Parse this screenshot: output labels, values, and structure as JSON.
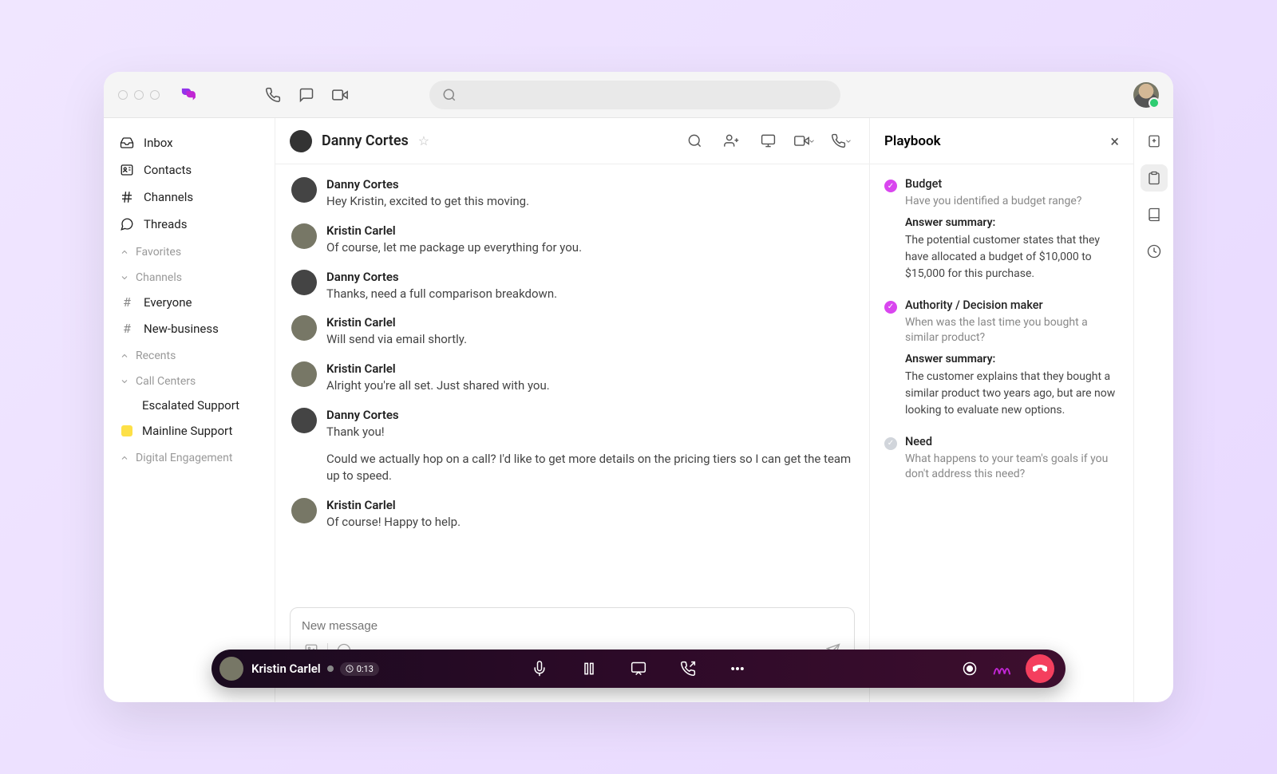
{
  "sidebar": {
    "main": [
      {
        "label": "Inbox"
      },
      {
        "label": "Contacts"
      },
      {
        "label": "Channels"
      },
      {
        "label": "Threads"
      }
    ],
    "favorites_label": "Favorites",
    "channels_label": "Channels",
    "channels": [
      {
        "label": "Everyone"
      },
      {
        "label": "New-business"
      }
    ],
    "recents_label": "Recents",
    "callcenters_label": "Call Centers",
    "callcenters": [
      {
        "label": "Escalated Support",
        "color": "#ec4899"
      },
      {
        "label": "Mainline Support",
        "color": "#fde047"
      }
    ],
    "digital_label": "Digital Engagement"
  },
  "conversation": {
    "title": "Danny Cortes",
    "messages": [
      {
        "name": "Danny Cortes",
        "text": "Hey Kristin, excited to get this moving.",
        "who": "a"
      },
      {
        "name": "Kristin Carlel",
        "text": "Of course, let me package up everything for you.",
        "who": "b"
      },
      {
        "name": "Danny Cortes",
        "text": "Thanks, need a full comparison breakdown.",
        "who": "a"
      },
      {
        "name": "Kristin Carlel",
        "text": "Will send via email shortly.",
        "who": "b"
      },
      {
        "name": "Kristin Carlel",
        "text": "Alright you're all set. Just shared with you.",
        "who": "b"
      },
      {
        "name": "Danny Cortes",
        "text": "Thank you!",
        "text2": "Could we actually hop on a call? I'd like to get more details on the pricing tiers so I can get the team up to speed.",
        "who": "a"
      },
      {
        "name": "Kristin Carlel",
        "text": "Of course! Happy to help.",
        "who": "b"
      }
    ],
    "composer_placeholder": "New message"
  },
  "playbook": {
    "title": "Playbook",
    "items": [
      {
        "status": "done",
        "title": "Budget",
        "question": "Have you identified a budget range?",
        "summary_label": "Answer summary:",
        "summary": "The potential customer states that they have allocated a budget of $10,000 to $15,000 for this purchase."
      },
      {
        "status": "done",
        "title": "Authority / Decision maker",
        "question": "When was the last time you bought a similar product?",
        "summary_label": "Answer summary:",
        "summary": "The customer explains that they bought a similar product two years ago, but are now looking to evaluate new options."
      },
      {
        "status": "pending",
        "title": "Need",
        "question": "What happens to your team's goals if you don't address this need?"
      }
    ]
  },
  "callbar": {
    "name": "Kristin Carlel",
    "timer": "0:13"
  }
}
